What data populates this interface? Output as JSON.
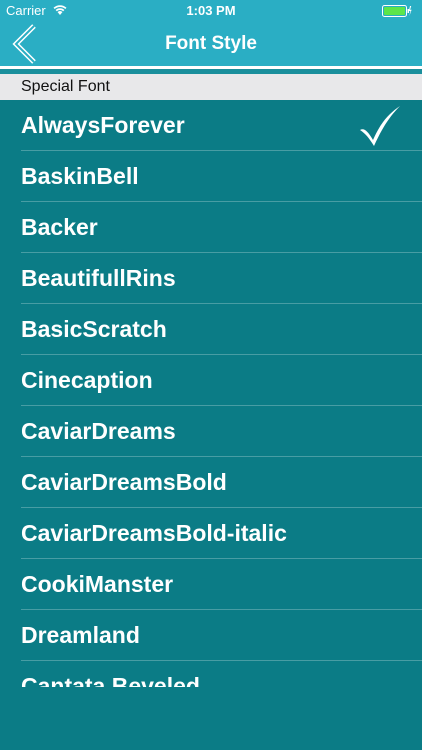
{
  "status_bar": {
    "carrier": "Carrier",
    "time": "1:03 PM",
    "wifi_icon": "wifi-icon",
    "battery_icon": "battery-icon"
  },
  "nav": {
    "title": "Font Style",
    "back_icon": "chevron-left-icon"
  },
  "section": {
    "header": "Special Font"
  },
  "fonts": [
    {
      "label": "AlwaysForever",
      "selected": true
    },
    {
      "label": "BaskinBell",
      "selected": false
    },
    {
      "label": "Backer",
      "selected": false
    },
    {
      "label": "BeautifullRins",
      "selected": false
    },
    {
      "label": "BasicScratch",
      "selected": false
    },
    {
      "label": "Cinecaption",
      "selected": false
    },
    {
      "label": "CaviarDreams",
      "selected": false
    },
    {
      "label": "CaviarDreamsBold",
      "selected": false
    },
    {
      "label": "CaviarDreamsBold-italic",
      "selected": false
    },
    {
      "label": "CookiManster",
      "selected": false
    },
    {
      "label": "Dreamland",
      "selected": false
    },
    {
      "label": "Cantata Beveled",
      "selected": false
    }
  ],
  "colors": {
    "nav_background": "#2aaec4",
    "list_background": "#0b7c86",
    "section_header_background": "#e8e8ea"
  }
}
